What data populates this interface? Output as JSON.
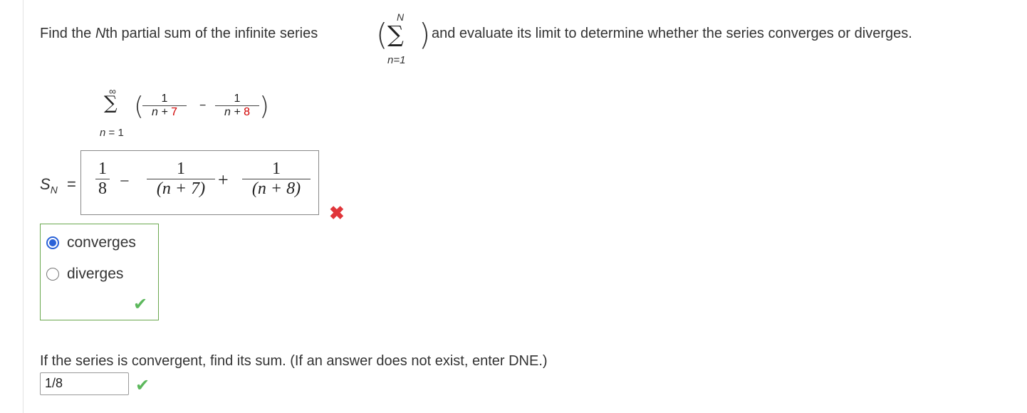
{
  "question": {
    "text_before": "Find the ",
    "var_N": "N",
    "text_mid": "th partial sum of the infinite series",
    "sigma": "∑",
    "sigma_upper": "N",
    "sigma_lower": "n=1",
    "text_after": "and evaluate its limit to determine whether the series converges or diverges."
  },
  "series": {
    "sigma": "∑",
    "upper": "∞",
    "lower": "n = 1",
    "term1_num": "1",
    "term1_den_var": "n + ",
    "term1_den_const": "7",
    "minus": "−",
    "term2_num": "1",
    "term2_den_var": "n + ",
    "term2_den_const": "8"
  },
  "partial_sum": {
    "label_S": "S",
    "label_N": "N",
    "equals": "=",
    "answer": {
      "f1_num": "1",
      "f1_den": "8",
      "op1": "−",
      "f2_num": "1",
      "f2_den": "(n + 7)",
      "op2": "+",
      "f3_num": "1",
      "f3_den": "(n + 8)"
    },
    "status": "incorrect",
    "status_mark": "✖",
    "status_color": "#e0353a"
  },
  "convergence": {
    "options": [
      {
        "label": "converges",
        "selected": true
      },
      {
        "label": "diverges",
        "selected": false
      }
    ],
    "status": "correct",
    "status_mark": "✔",
    "status_color": "#5cb85c"
  },
  "sum_question": {
    "text": "If the series is convergent, find its sum. (If an answer does not exist, enter DNE.)",
    "answer": "1/8",
    "status": "correct",
    "status_mark": "✔"
  }
}
